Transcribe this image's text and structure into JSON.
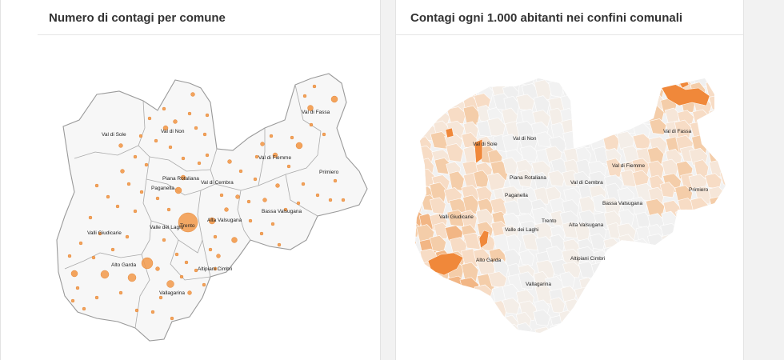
{
  "panels": {
    "left": {
      "title": "Numero di contagi per comune"
    },
    "right": {
      "title": "Contagi ogni 1.000 abitanti nei confini comunali"
    }
  },
  "colors": {
    "bubble": "#f2994a",
    "land": "#f7f7f7",
    "border": "#9a9a9a",
    "choropleth_low": "#f1f1f1",
    "choropleth_mid": "#f7d2b2",
    "choropleth_high": "#f0883a"
  },
  "map_left": {
    "labels": {
      "val_di_sole": "Val di Sole",
      "val_di_non": "Val di Non",
      "val_di_fassa": "Val di Fassa",
      "val_di_fiemme": "Val di Fiemme",
      "primiero": "Primiero",
      "piana_rotaliana": "Piana Rotaliana",
      "paganella": "Paganella",
      "val_di_cembra": "Val di Cembra",
      "valli_giudicarie": "Valli Giudicarie",
      "valle_dei_laghi": "Valle dei Laghi",
      "trento": "Trento",
      "alta_valsugana": "Alta Valsugana",
      "bassa_valsugana": "Bassa Valsugana",
      "alto_garda": "Alto Garda",
      "altipiani_cimbri": "Altipiani Cimbri",
      "vallagarina": "Vallagarina"
    }
  },
  "map_right": {
    "labels": {
      "val_di_sole": "Val di Sole",
      "val_di_non": "Val di Non",
      "val_di_fassa": "Val di Fassa",
      "val_di_fiemme": "Val di Fiemme",
      "primiero": "Primiero",
      "piana_rotaliana": "Piana Rotaliana",
      "paganella": "Paganella",
      "val_di_cembra": "Val di Cembra",
      "bassa_valsugana": "Bassa Valsugana",
      "valli_giudicarie": "Valli Giudicarie",
      "trento": "Trento",
      "valle_dei_laghi": "Valle dei Laghi",
      "alta_valsugana": "Alta Valsugana",
      "alto_garda": "Alto Garda",
      "altipiani_cimbri": "Altipiani Cimbri",
      "vallagarina": "Vallagarina"
    }
  }
}
